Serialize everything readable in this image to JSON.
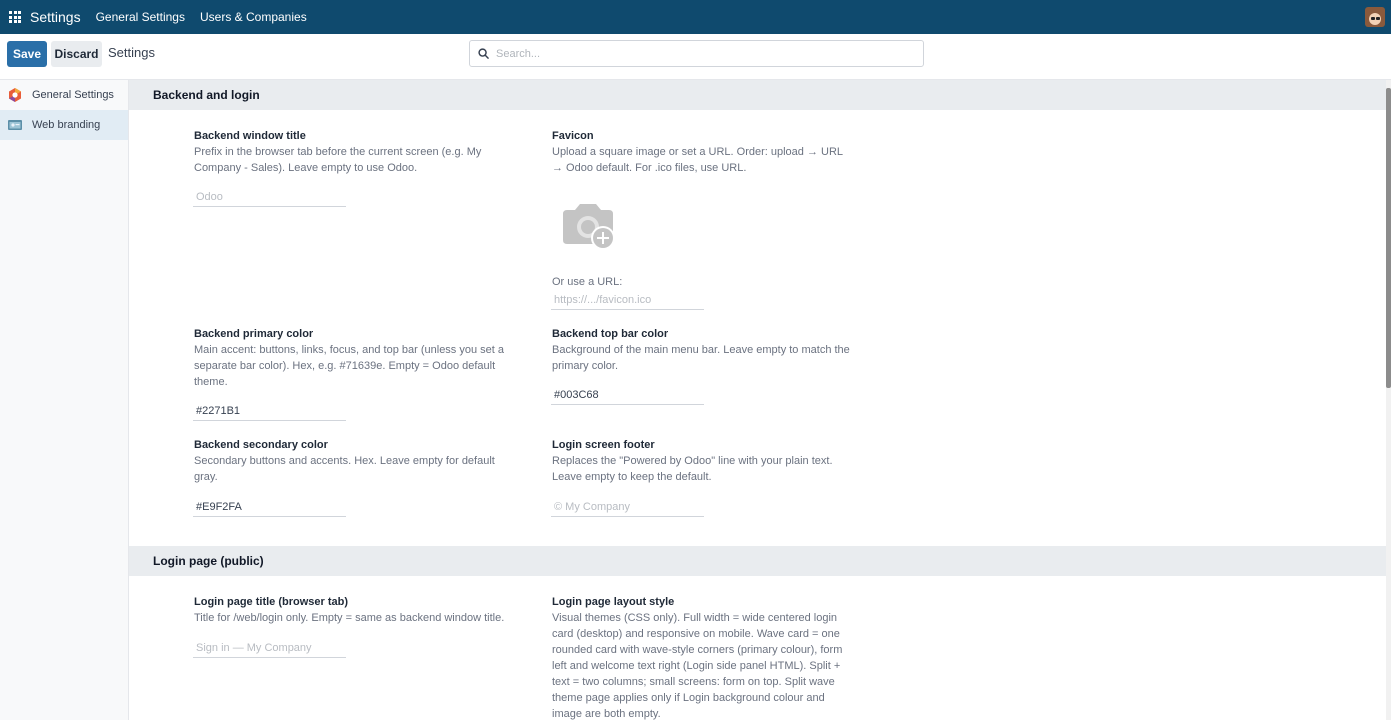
{
  "navbar": {
    "brand": "Settings",
    "links": [
      "General Settings",
      "Users & Companies"
    ]
  },
  "control": {
    "save_label": "Save",
    "discard_label": "Discard",
    "title": "Settings",
    "search_placeholder": "Search..."
  },
  "sidebar": {
    "items": [
      {
        "label": "General Settings",
        "icon": "settings-app-icon"
      },
      {
        "label": "Web branding",
        "icon": "web-branding-icon"
      }
    ]
  },
  "sections": {
    "backend": {
      "heading": "Backend and login",
      "window_title": {
        "title": "Backend window title",
        "desc": "Prefix in the browser tab before the current screen (e.g. My Company - Sales). Leave empty to use Odoo.",
        "placeholder": "Odoo"
      },
      "favicon": {
        "title": "Favicon",
        "desc": "Upload a square image or set a URL. Order: upload → URL → Odoo default. For .ico files, use URL.",
        "url_label": "Or use a URL:",
        "url_placeholder": "https://.../favicon.ico"
      },
      "primary_color": {
        "title": "Backend primary color",
        "desc": "Main accent: buttons, links, focus, and top bar (unless you set a separate bar color). Hex, e.g. #71639e. Empty = Odoo default theme.",
        "value": "#2271B1"
      },
      "top_bar_color": {
        "title": "Backend top bar color",
        "desc": "Background of the main menu bar. Leave empty to match the primary color.",
        "value": "#003C68"
      },
      "secondary_color": {
        "title": "Backend secondary color",
        "desc": "Secondary buttons and accents. Hex. Leave empty for default gray.",
        "value": "#E9F2FA"
      },
      "login_footer": {
        "title": "Login screen footer",
        "desc": "Replaces the \"Powered by Odoo\" line with your plain text. Leave empty to keep the default.",
        "placeholder": "© My Company"
      }
    },
    "login": {
      "heading": "Login page (public)",
      "page_title": {
        "title": "Login page title (browser tab)",
        "desc": "Title for /web/login only. Empty = same as backend window title.",
        "placeholder": "Sign in — My Company"
      },
      "layout_style": {
        "title": "Login page layout style",
        "desc": "Visual themes (CSS only). Full width = wide centered login card (desktop) and responsive on mobile. Wave card = one rounded card with wave-style corners (primary colour), form left and welcome text right (Login side panel HTML). Split + text = two columns; small screens: form on top. Split wave theme page applies only if Login background colour and image are both empty."
      }
    }
  },
  "colors": {
    "navbar_bg": "#0f4a6e",
    "save_btn": "#2a6fa8",
    "section_bg": "#e9ecef",
    "sidebar_active": "#e1ecf4"
  }
}
